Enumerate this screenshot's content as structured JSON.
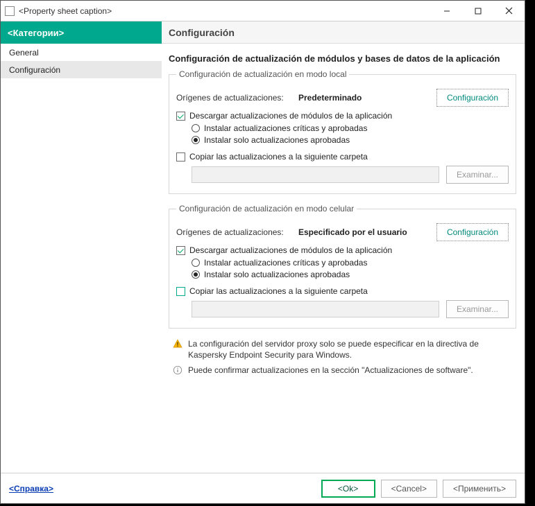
{
  "titlebar": {
    "caption": "<Property sheet caption>"
  },
  "sidebar": {
    "header": "<Категории>",
    "items": [
      {
        "label": "General"
      },
      {
        "label": "Configuración"
      }
    ]
  },
  "main": {
    "header": "Configuración",
    "section_title": "Configuración de actualización de módulos y bases de datos de la aplicación",
    "local": {
      "legend": "Configuración de actualización en modo local",
      "sources_label": "Orígenes de actualizaciones:",
      "sources_value": "Predeterminado",
      "config_btn": "Configuración",
      "download_modules": "Descargar actualizaciones de módulos de la aplicación",
      "radio1": "Instalar actualizaciones críticas y aprobadas",
      "radio2": "Instalar solo actualizaciones aprobadas",
      "copy_to_folder": "Copiar las actualizaciones a la siguiente carpeta",
      "browse": "Examinar..."
    },
    "cellular": {
      "legend": "Configuración de actualización en modo celular",
      "sources_label": "Orígenes de actualizaciones:",
      "sources_value": "Especificado por el usuario",
      "config_btn": "Configuración",
      "download_modules": "Descargar actualizaciones de módulos de la aplicación",
      "radio1": "Instalar actualizaciones críticas y aprobadas",
      "radio2": "Instalar solo actualizaciones aprobadas",
      "copy_to_folder": "Copiar las actualizaciones a la siguiente carpeta",
      "browse": "Examinar..."
    },
    "warn_text": "La configuración del servidor proxy solo se puede especificar en la directiva de Kaspersky Endpoint Security para Windows.",
    "info_text": "Puede confirmar actualizaciones en la sección \"Actualizaciones de software\"."
  },
  "footer": {
    "help": "<Справка>",
    "ok": "<Ok>",
    "cancel": "<Cancel>",
    "apply": "<Применить>"
  }
}
